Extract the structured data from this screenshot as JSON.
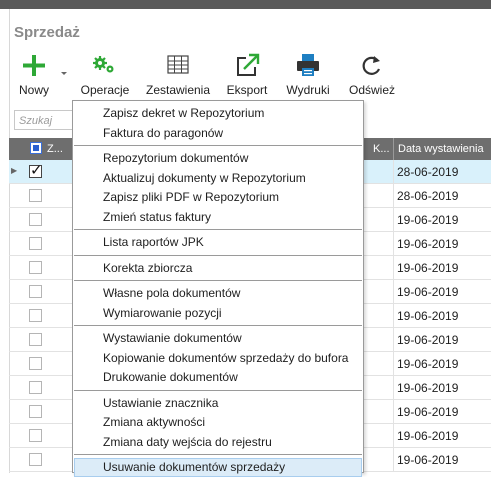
{
  "section_title": "Sprzedaż",
  "toolbar": {
    "new": "Nowy",
    "operations": "Operacje",
    "reports": "Zestawienia",
    "export": "Eksport",
    "printouts": "Wydruki",
    "refresh": "Odśwież"
  },
  "search": {
    "placeholder": "Szukaj"
  },
  "grid": {
    "columns": [
      "Z...",
      "K...",
      "Data wystawienia"
    ],
    "rows": [
      {
        "checked": true,
        "selected": true,
        "date": "28-06-2019"
      },
      {
        "checked": false,
        "selected": false,
        "date": "28-06-2019"
      },
      {
        "checked": false,
        "selected": false,
        "date": "19-06-2019"
      },
      {
        "checked": false,
        "selected": false,
        "date": "19-06-2019"
      },
      {
        "checked": false,
        "selected": false,
        "date": "19-06-2019"
      },
      {
        "checked": false,
        "selected": false,
        "date": "19-06-2019"
      },
      {
        "checked": false,
        "selected": false,
        "date": "19-06-2019"
      },
      {
        "checked": false,
        "selected": false,
        "date": "19-06-2019"
      },
      {
        "checked": false,
        "selected": false,
        "date": "19-06-2019"
      },
      {
        "checked": false,
        "selected": false,
        "date": "19-06-2019"
      },
      {
        "checked": false,
        "selected": false,
        "date": "19-06-2019"
      },
      {
        "checked": false,
        "selected": false,
        "date": "19-06-2019"
      },
      {
        "checked": false,
        "selected": false,
        "date": "19-06-2019"
      }
    ]
  },
  "menu": {
    "groups": [
      [
        "Zapisz dekret w Repozytorium",
        "Faktura do paragonów"
      ],
      [
        "Repozytorium dokumentów",
        "Aktualizuj dokumenty w Repozytorium",
        "Zapisz pliki PDF w Repozytorium",
        "Zmień status faktury"
      ],
      [
        "Lista raportów JPK"
      ],
      [
        "Korekta zbiorcza"
      ],
      [
        "Własne pola dokumentów",
        "Wymiarowanie pozycji"
      ],
      [
        "Wystawianie dokumentów",
        "Kopiowanie dokumentów sprzedaży do bufora",
        "Drukowanie dokumentów"
      ],
      [
        "Ustawianie znacznika",
        "Zmiana aktywności",
        "Zmiana daty wejścia do rejestru"
      ],
      [
        "Usuwanie dokumentów sprzedaży"
      ]
    ],
    "highlighted": "Usuwanie dokumentów sprzedaży"
  },
  "colors": {
    "accent_green": "#2ea836",
    "accent_blue": "#1e7fc2",
    "header_gray": "#6e6e6e",
    "selection": "#d9f1fb"
  },
  "icons": [
    "plus-icon",
    "chevron-down-icon",
    "gears-icon",
    "table-icon",
    "export-arrow-icon",
    "printer-icon",
    "refresh-icon"
  ]
}
